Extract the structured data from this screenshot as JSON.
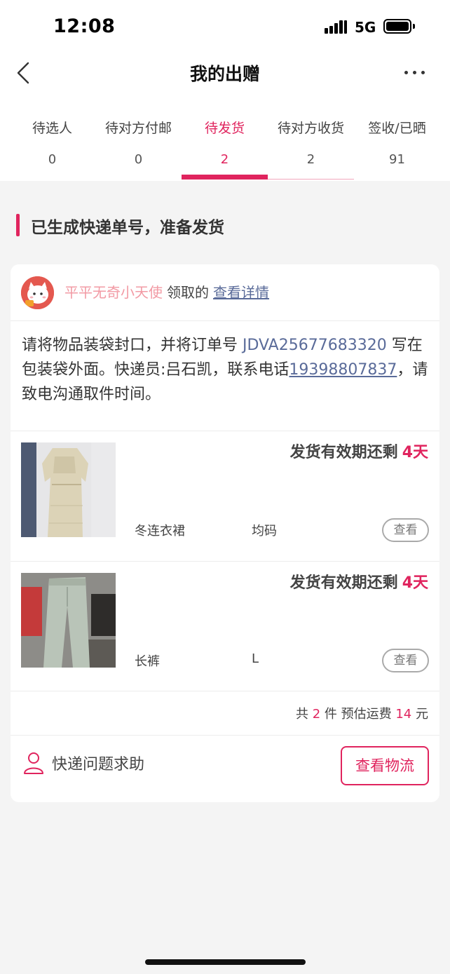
{
  "status_bar": {
    "time": "12:08",
    "network": "5G"
  },
  "nav": {
    "title": "我的出赠"
  },
  "tabs": [
    {
      "label": "待选人",
      "count": "0"
    },
    {
      "label": "待对方付邮",
      "count": "0"
    },
    {
      "label": "待发货",
      "count": "2"
    },
    {
      "label": "待对方收货",
      "count": "2"
    },
    {
      "label": "签收/已晒",
      "count": "91"
    }
  ],
  "active_tab_index": 2,
  "section": {
    "title": "已生成快递单号，准备发货"
  },
  "order": {
    "user_name": "平平无奇小天使",
    "action": "领取的",
    "detail_link": "查看详情",
    "instructions": {
      "part1": "请将物品装袋封口，并将订单号 ",
      "order_code": "JDVA25677683320",
      "part2": " 写在包装袋外面。快递员:吕石凯，联系电话",
      "phone": "19398807837",
      "part3": "，请致电沟通取件时间。"
    },
    "items": [
      {
        "deadline_label": "发货有效期还剩",
        "days": "4天",
        "name": "冬连衣裙",
        "size": "均码",
        "view_label": "查看"
      },
      {
        "deadline_label": "发货有效期还剩",
        "days": "4天",
        "name": "长裤",
        "size": "L",
        "view_label": "查看"
      }
    ],
    "summary": {
      "prefix": "共",
      "count": "2",
      "mid": "件 预估运费",
      "fee": "14",
      "unit": "元"
    },
    "help_label": "快递问题求助",
    "logistics_button": "查看物流"
  },
  "colors": {
    "accent": "#e0245e",
    "link": "#5a6b99",
    "user_name": "#f29aa4",
    "background": "#f4f4f4"
  },
  "icons": {
    "back": "chevron-left-icon",
    "more": "more-dots-icon",
    "help": "person-icon"
  }
}
